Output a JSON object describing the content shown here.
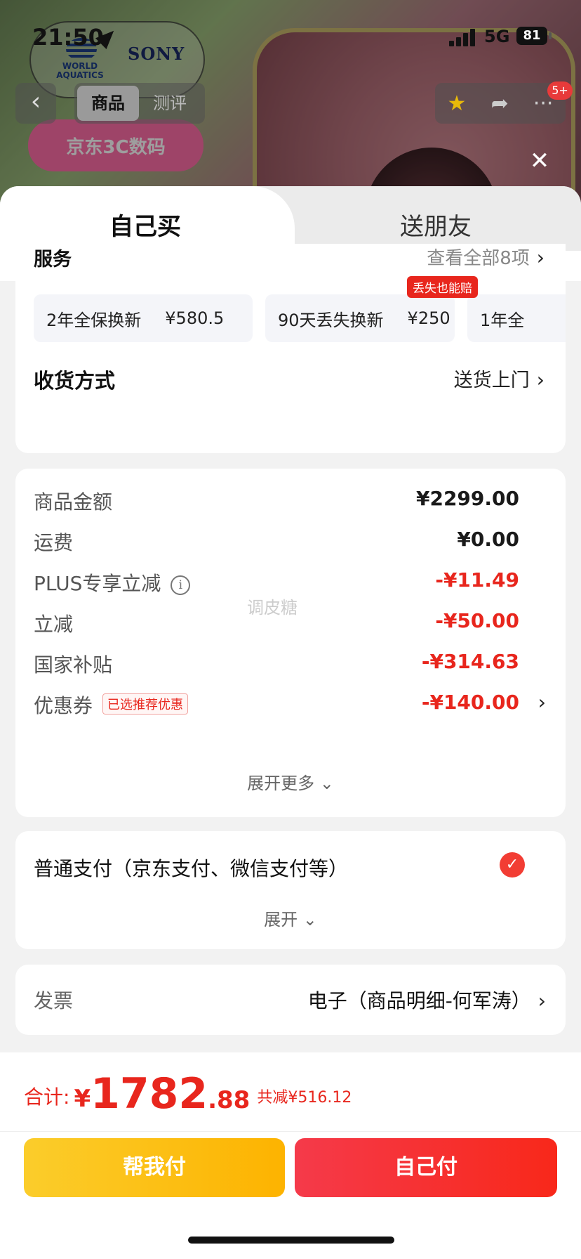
{
  "status_bar": {
    "time": "21:50",
    "network": "5G",
    "battery": "81"
  },
  "background": {
    "logo_left": "WORLD AQUATICS",
    "logo_right": "SONY",
    "banner": "京东3C数码",
    "nav_tabs": [
      "商品",
      "测评"
    ],
    "cart_badge": "5+"
  },
  "sheet": {
    "tabs": {
      "self": "自己买",
      "gift": "送朋友"
    },
    "service": {
      "title": "服务",
      "view_all": "查看全部8项",
      "items": [
        {
          "name": "2年全保换新",
          "price": "¥580.5"
        },
        {
          "name": "90天丢失换新",
          "price": "¥250",
          "tag": "丢失也能赔"
        },
        {
          "name": "1年全",
          "price": ""
        }
      ]
    },
    "delivery": {
      "label": "收货方式",
      "value": "送货上门"
    },
    "price_detail": {
      "watermark": "调皮糖",
      "rows": [
        {
          "label": "商品金额",
          "value": "¥2299.00"
        },
        {
          "label": "运费",
          "value": "¥0.00"
        },
        {
          "label": "PLUS专享立减",
          "value": "-¥11.49"
        },
        {
          "label": "立减",
          "value": "-¥50.00"
        },
        {
          "label": "国家补贴",
          "value": "-¥314.63"
        },
        {
          "label": "优惠券",
          "tag": "已选推荐优惠",
          "value": "-¥140.00"
        }
      ],
      "expand_more": "展开更多"
    },
    "payment": {
      "method": "普通支付（京东支付、微信支付等）",
      "expand": "展开"
    },
    "invoice": {
      "label": "发票",
      "value": "电子（商品明细-何军涛）"
    }
  },
  "bottom_bar": {
    "total_label": "合计:",
    "currency": "¥",
    "total_integer": "1782",
    "total_decimal": ".88",
    "saved": "共减¥516.12",
    "help_pay": "帮我付",
    "self_pay": "自己付"
  },
  "colors": {
    "accent_red": "#e8261d",
    "help_button": "#fdb300",
    "pay_button": "#f5303a"
  }
}
